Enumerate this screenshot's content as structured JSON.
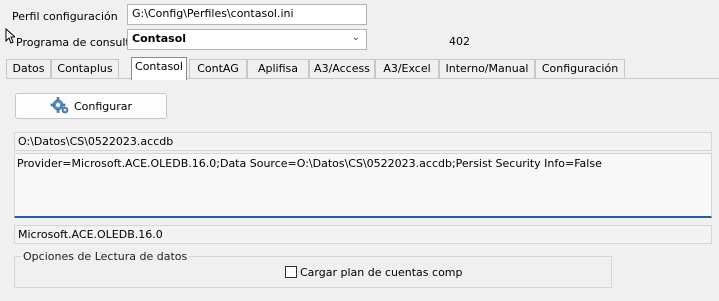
{
  "header": {
    "profile_label": "Perfil configuración",
    "profile_path": "G:\\Config\\Perfiles\\contasol.ini",
    "program_label": "Programa de consulta",
    "program_value": "Contasol",
    "program_code": "402"
  },
  "tabs": [
    {
      "label": "Datos",
      "active": false
    },
    {
      "label": "Contaplus",
      "active": false
    },
    {
      "label": "Contasol",
      "active": true
    },
    {
      "label": "ContAG",
      "active": false
    },
    {
      "label": "Aplifisa",
      "active": false
    },
    {
      "label": "A3/Access",
      "active": false
    },
    {
      "label": "A3/Excel",
      "active": false
    },
    {
      "label": "Interno/Manual",
      "active": false
    },
    {
      "label": "Configuración",
      "active": false
    }
  ],
  "panel": {
    "configure_label": "Configurar",
    "db_path": "O:\\Datos\\CS\\0522023.accdb",
    "connection_string": "Provider=Microsoft.ACE.OLEDB.16.0;Data Source=O:\\Datos\\CS\\0522023.accdb;Persist Security Info=False",
    "provider": "Microsoft.ACE.OLEDB.16.0",
    "read_options_title": "Opciones de Lectura de datos",
    "load_accounts_label": "Cargar plan de cuentas comp",
    "load_accounts_checked": false
  },
  "icons": {
    "configure": "gear-icon",
    "combo_arrow": "chevron-down-icon",
    "cursor": "mouse-cursor-icon"
  },
  "colors": {
    "accent_underline": "#1f5fa6"
  }
}
